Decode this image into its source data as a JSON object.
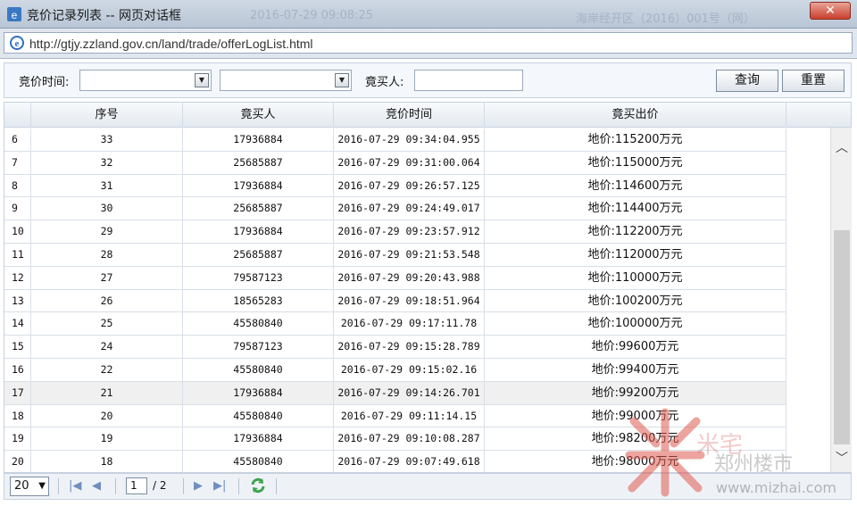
{
  "window": {
    "title": "竞价记录列表 -- 网页对话框",
    "close_glyph": "✕",
    "url": "http://gtjy.zzland.gov.cn/land/trade/offerLogList.html",
    "background_text": [
      "2016-07-29 09:08:25",
      "海岸经开区（2016）001号（网）"
    ]
  },
  "search": {
    "time_label": "竞价时间:",
    "time_from": "",
    "time_sep": "",
    "time_to": "",
    "buyer_label": "竟买人:",
    "buyer_value": "",
    "query_button": "查询",
    "reset_button": "重置"
  },
  "table": {
    "columns": [
      "",
      "序号",
      "竟买人",
      "竞价时间",
      "竟买出价"
    ],
    "rows": [
      {
        "idx": "6",
        "seq": "33",
        "buyer": "17936884",
        "time": "2016-07-29 09:34:04.955",
        "price": "地价:115200万元"
      },
      {
        "idx": "7",
        "seq": "32",
        "buyer": "25685887",
        "time": "2016-07-29 09:31:00.064",
        "price": "地价:115000万元"
      },
      {
        "idx": "8",
        "seq": "31",
        "buyer": "17936884",
        "time": "2016-07-29 09:26:57.125",
        "price": "地价:114600万元"
      },
      {
        "idx": "9",
        "seq": "30",
        "buyer": "25685887",
        "time": "2016-07-29 09:24:49.017",
        "price": "地价:114400万元"
      },
      {
        "idx": "10",
        "seq": "29",
        "buyer": "17936884",
        "time": "2016-07-29 09:23:57.912",
        "price": "地价:112200万元"
      },
      {
        "idx": "11",
        "seq": "28",
        "buyer": "25685887",
        "time": "2016-07-29 09:21:53.548",
        "price": "地价:112000万元"
      },
      {
        "idx": "12",
        "seq": "27",
        "buyer": "79587123",
        "time": "2016-07-29 09:20:43.988",
        "price": "地价:110000万元"
      },
      {
        "idx": "13",
        "seq": "26",
        "buyer": "18565283",
        "time": "2016-07-29 09:18:51.964",
        "price": "地价:100200万元"
      },
      {
        "idx": "14",
        "seq": "25",
        "buyer": "45580840",
        "time": "2016-07-29 09:17:11.78",
        "price": "地价:100000万元"
      },
      {
        "idx": "15",
        "seq": "24",
        "buyer": "79587123",
        "time": "2016-07-29 09:15:28.789",
        "price": "地价:99600万元"
      },
      {
        "idx": "16",
        "seq": "22",
        "buyer": "45580840",
        "time": "2016-07-29 09:15:02.16",
        "price": "地价:99400万元"
      },
      {
        "idx": "17",
        "seq": "21",
        "buyer": "17936884",
        "time": "2016-07-29 09:14:26.701",
        "price": "地价:99200万元"
      },
      {
        "idx": "18",
        "seq": "20",
        "buyer": "45580840",
        "time": "2016-07-29 09:11:14.15",
        "price": "地价:99000万元"
      },
      {
        "idx": "19",
        "seq": "19",
        "buyer": "17936884",
        "time": "2016-07-29 09:10:08.287",
        "price": "地价:98200万元"
      },
      {
        "idx": "20",
        "seq": "18",
        "buyer": "45580840",
        "time": "2016-07-29 09:07:49.618",
        "price": "地价:98000万元"
      }
    ]
  },
  "pager": {
    "page_size": "20",
    "current_page": "1",
    "total_pages": "/ 2",
    "first_icon": "|◀",
    "prev_icon": "◀",
    "next_icon": "▶",
    "last_icon": "▶|"
  },
  "watermark": {
    "brand": "米宅",
    "sub": "郑州楼市",
    "url": "www.mizhai.com"
  },
  "colors": {
    "accent": "#6f8fbf",
    "close": "#c9412e",
    "watermark": "#d9534f"
  }
}
